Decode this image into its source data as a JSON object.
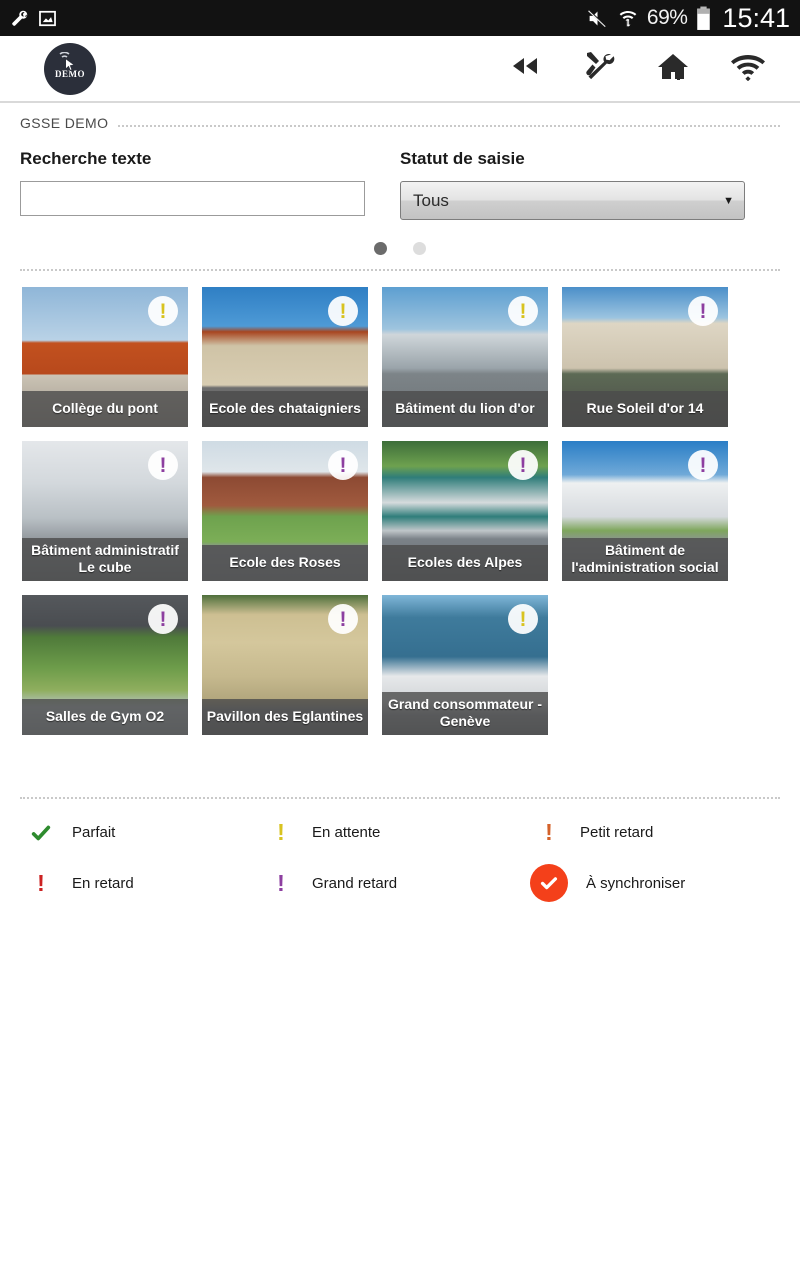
{
  "statusbar": {
    "left_icons": [
      "wrench-icon",
      "screenshot-icon"
    ],
    "right_icons": [
      "mute-icon",
      "wifi-transfer-icon"
    ],
    "battery_percent": "69%",
    "clock": "15:41"
  },
  "appbar": {
    "logo_label": "DEMO",
    "actions": [
      {
        "name": "rewind-icon",
        "label": "Retour"
      },
      {
        "name": "tools-icon",
        "label": "Outils"
      },
      {
        "name": "home-icon",
        "label": "Accueil"
      },
      {
        "name": "wifi-icon",
        "label": "Connexion"
      }
    ]
  },
  "panel": {
    "title": "GSSE DEMO",
    "search": {
      "label": "Recherche texte",
      "value": "",
      "placeholder": ""
    },
    "status": {
      "label": "Statut de saisie",
      "selected": "Tous",
      "caret": "▼",
      "options": [
        "Tous"
      ]
    },
    "pager": {
      "count": 2,
      "active": 0
    }
  },
  "cards": [
    {
      "name": "Collège du pont",
      "status": "en-attente",
      "color": "#d8c320",
      "glyph": "!",
      "photo": "collge-du-pont-photo"
    },
    {
      "name": "Ecole des chataigniers",
      "status": "en-attente",
      "color": "#d8c320",
      "glyph": "!",
      "photo": "ecole-des-chataigniers-photo"
    },
    {
      "name": "Bâtiment du lion d'or",
      "status": "en-attente",
      "color": "#d8c320",
      "glyph": "!",
      "photo": "batiment-du-lion-dor-photo"
    },
    {
      "name": "Rue Soleil d'or 14",
      "status": "grand-retard",
      "color": "#8d3fa0",
      "glyph": "!",
      "photo": "rue-soleil-dor-14-photo"
    },
    {
      "name": "Bâtiment administratif Le cube",
      "status": "grand-retard",
      "color": "#8d3fa0",
      "glyph": "!",
      "photo": "batiment-administratif-le-cube-photo"
    },
    {
      "name": "Ecole des Roses",
      "status": "grand-retard",
      "color": "#8d3fa0",
      "glyph": "!",
      "photo": "ecole-des-roses-photo"
    },
    {
      "name": "Ecoles des Alpes",
      "status": "grand-retard",
      "color": "#8d3fa0",
      "glyph": "!",
      "photo": "ecoles-des-alpes-photo"
    },
    {
      "name": "Bâtiment de l'administration social",
      "status": "grand-retard",
      "color": "#8d3fa0",
      "glyph": "!",
      "photo": "batiment-administration-social-photo"
    },
    {
      "name": "Salles de Gym O2",
      "status": "grand-retard",
      "color": "#8d3fa0",
      "glyph": "!",
      "photo": "salles-de-gym-o2-photo"
    },
    {
      "name": "Pavillon des Eglantines",
      "status": "grand-retard",
      "color": "#8d3fa0",
      "glyph": "!",
      "photo": "pavillon-des-eglantines-photo"
    },
    {
      "name": "Grand consommateur - Genève",
      "status": "en-attente",
      "color": "#d8c320",
      "glyph": "!",
      "photo": "grand-consommateur-geneve-photo"
    }
  ],
  "legend": [
    {
      "label": "Parfait",
      "icon": "check-icon",
      "glyph": "✔",
      "color": "#2e8b2e"
    },
    {
      "label": "En attente",
      "icon": "exclamation-icon",
      "glyph": "!",
      "color": "#d8c320"
    },
    {
      "label": "Petit retard",
      "icon": "exclamation-icon",
      "glyph": "!",
      "color": "#d4622a"
    },
    {
      "label": "En retard",
      "icon": "exclamation-icon",
      "glyph": "!",
      "color": "#cc2222"
    },
    {
      "label": "Grand retard",
      "icon": "exclamation-icon",
      "glyph": "!",
      "color": "#8d3fa0"
    },
    {
      "label": "À synchroniser",
      "icon": "sync-check-icon",
      "glyph": "✔",
      "color": "#f4401a"
    }
  ]
}
